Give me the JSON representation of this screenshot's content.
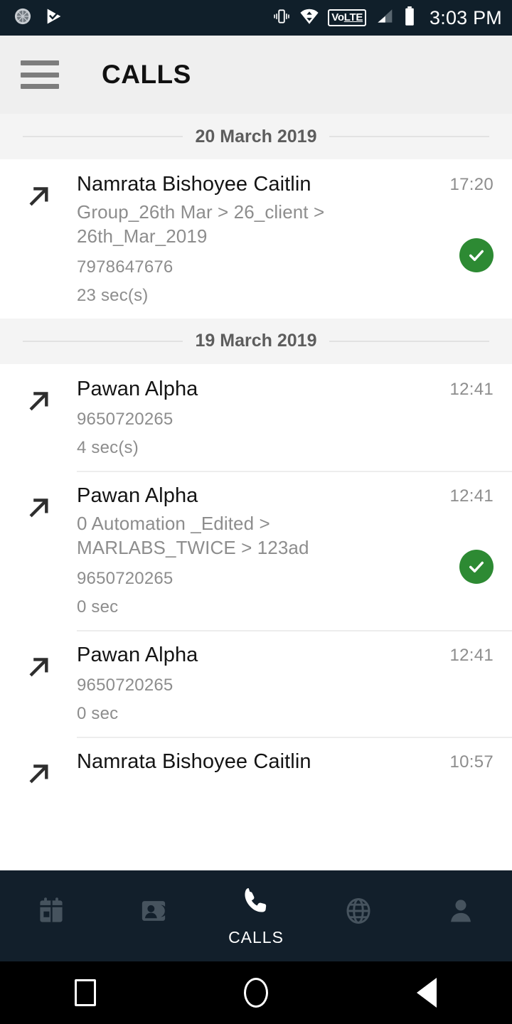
{
  "statusbar": {
    "icons_left": [
      "sync-circle-icon",
      "play-check-icon"
    ],
    "icons_right": [
      "vibrate-icon",
      "wifi-transfer-icon",
      "volte-badge",
      "signal-bars-icon",
      "battery-icon"
    ],
    "volte_label_first": "Vo",
    "volte_label_second": "LTE",
    "clock": "3:03 PM",
    "background_color": "#101f2a"
  },
  "appbar": {
    "menu_icon": "hamburger-menu-icon",
    "title": "CALLS",
    "background_color": "#efefef"
  },
  "list": {
    "sections": [
      {
        "date": "20 March 2019",
        "calls": [
          {
            "direction_icon": "outgoing-call-arrow-icon",
            "name": "Namrata Bishoyee Caitlin",
            "subtitle": "Group_26th Mar > 26_client > 26th_Mar_2019",
            "number": "7978647676",
            "duration": "23 sec(s)",
            "time": "17:20",
            "status": "completed-check"
          }
        ]
      },
      {
        "date": "19 March 2019",
        "calls": [
          {
            "direction_icon": "outgoing-call-arrow-icon",
            "name": "Pawan Alpha",
            "subtitle": "",
            "number": "9650720265",
            "duration": "4 sec(s)",
            "time": "12:41",
            "status": ""
          },
          {
            "direction_icon": "outgoing-call-arrow-icon",
            "name": "Pawan Alpha",
            "subtitle": "0 Automation _Edited > MARLABS_TWICE > 123ad",
            "number": "9650720265",
            "duration": "0 sec",
            "time": "12:41",
            "status": "completed-check"
          },
          {
            "direction_icon": "outgoing-call-arrow-icon",
            "name": "Pawan Alpha",
            "subtitle": "",
            "number": "9650720265",
            "duration": "0 sec",
            "time": "12:41",
            "status": ""
          },
          {
            "direction_icon": "outgoing-call-arrow-icon",
            "name": "Namrata Bishoyee Caitlin",
            "subtitle": "",
            "number": "",
            "duration": "",
            "time": "10:57",
            "status": ""
          }
        ]
      }
    ]
  },
  "bottomnav": {
    "background_color": "#121f2b",
    "active_color": "#ffffff",
    "inactive_color": "#46535e",
    "items": [
      {
        "icon": "calendar-icon",
        "label": "",
        "active": false
      },
      {
        "icon": "contacts-icon",
        "label": "",
        "active": false
      },
      {
        "icon": "phone-icon",
        "label": "CALLS",
        "active": true
      },
      {
        "icon": "globe-icon",
        "label": "",
        "active": false
      },
      {
        "icon": "person-icon",
        "label": "",
        "active": false
      }
    ]
  },
  "sysnav": {
    "background_color": "#000000",
    "items": [
      {
        "icon": "recents-square-icon"
      },
      {
        "icon": "home-circle-icon"
      },
      {
        "icon": "back-triangle-icon"
      }
    ]
  },
  "colors": {
    "status_check_green": "#2d8a33",
    "divider": "#ededed",
    "section_bg": "#f4f4f4",
    "secondary_text": "#8d8d8d"
  }
}
